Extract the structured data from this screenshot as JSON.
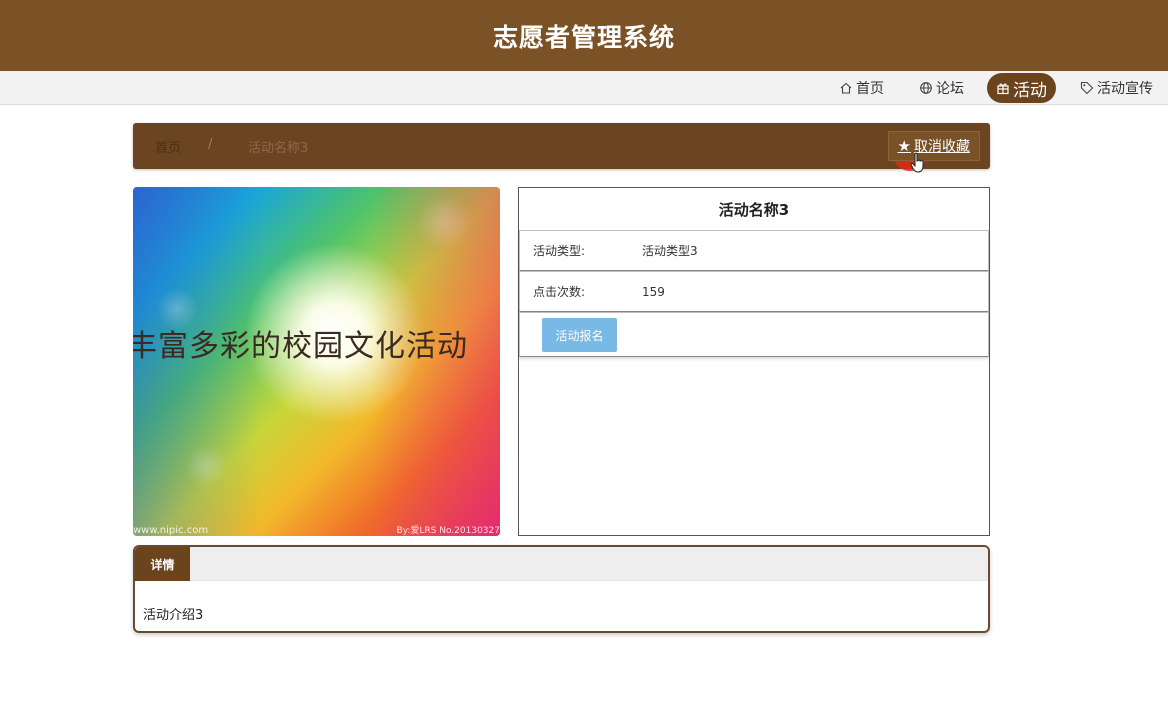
{
  "app": {
    "title": "志愿者管理系统"
  },
  "nav": {
    "items": [
      {
        "label": "首页",
        "icon": "home-icon"
      },
      {
        "label": "论坛",
        "icon": "globe-icon"
      },
      {
        "label": "活动",
        "icon": "gift-icon",
        "active": true
      },
      {
        "label": "活动宣传",
        "icon": "tag-icon"
      }
    ]
  },
  "breadcrumb": {
    "home": "首页",
    "separator": "/",
    "current": "活动名称3"
  },
  "favorite": {
    "label": "取消收藏",
    "icon": "star-icon"
  },
  "image": {
    "slogan": "丰富多彩的校园文化活动",
    "watermark_left": "www.nipic.com",
    "watermark_right": "By:爱LRS No.20130327"
  },
  "activity": {
    "title": "活动名称3",
    "rows": [
      {
        "label": "活动类型:",
        "value": "活动类型3"
      },
      {
        "label": "点击次数:",
        "value": "159"
      }
    ],
    "signup_label": "活动报名"
  },
  "detail": {
    "tab_label": "详情",
    "content": "活动介绍3"
  },
  "colors": {
    "brand_brown": "#7a5226",
    "dark_brown": "#6b441e",
    "signup_blue": "#78b9e6"
  }
}
